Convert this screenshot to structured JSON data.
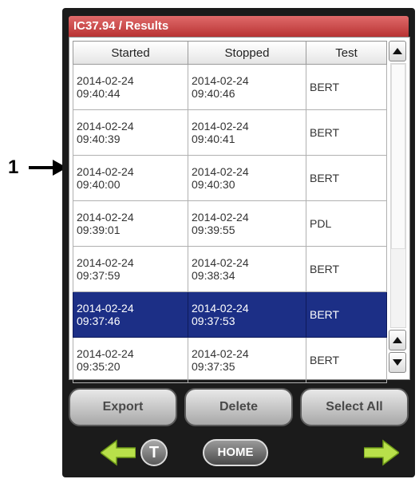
{
  "callout": {
    "label": "1"
  },
  "window": {
    "title": "IC37.94 / Results"
  },
  "table": {
    "columns": [
      "Started",
      "Stopped",
      "Test"
    ],
    "rows": [
      {
        "started_date": "2014-02-24",
        "started_time": "09:40:44",
        "stopped_date": "2014-02-24",
        "stopped_time": "09:40:46",
        "test": "BERT"
      },
      {
        "started_date": "2014-02-24",
        "started_time": "09:40:39",
        "stopped_date": "2014-02-24",
        "stopped_time": "09:40:41",
        "test": "BERT"
      },
      {
        "started_date": "2014-02-24",
        "started_time": "09:40:00",
        "stopped_date": "2014-02-24",
        "stopped_time": "09:40:30",
        "test": "BERT"
      },
      {
        "started_date": "2014-02-24",
        "started_time": "09:39:01",
        "stopped_date": "2014-02-24",
        "stopped_time": "09:39:55",
        "test": "PDL"
      },
      {
        "started_date": "2014-02-24",
        "started_time": "09:37:59",
        "stopped_date": "2014-02-24",
        "stopped_time": "09:38:34",
        "test": "BERT"
      },
      {
        "started_date": "2014-02-24",
        "started_time": "09:37:46",
        "stopped_date": "2014-02-24",
        "stopped_time": "09:37:53",
        "test": "BERT",
        "selected": true
      },
      {
        "started_date": "2014-02-24",
        "started_time": "09:35:20",
        "stopped_date": "2014-02-24",
        "stopped_time": "09:37:35",
        "test": "BERT"
      }
    ]
  },
  "buttons": {
    "export": "Export",
    "delete": "Delete",
    "select_all": "Select All"
  },
  "nav": {
    "home": "HOME",
    "tools": "T"
  },
  "icons": {
    "callout_arrow": "right-arrow-icon",
    "scroll_up": "triangle-up-icon",
    "scroll_down": "triangle-down-icon",
    "nav_back": "left-arrow-icon",
    "nav_forward": "right-arrow-icon"
  },
  "colors": {
    "titlebar": "#c94444",
    "selection": "#1c2f86",
    "nav_arrow": "#b8e04a"
  }
}
